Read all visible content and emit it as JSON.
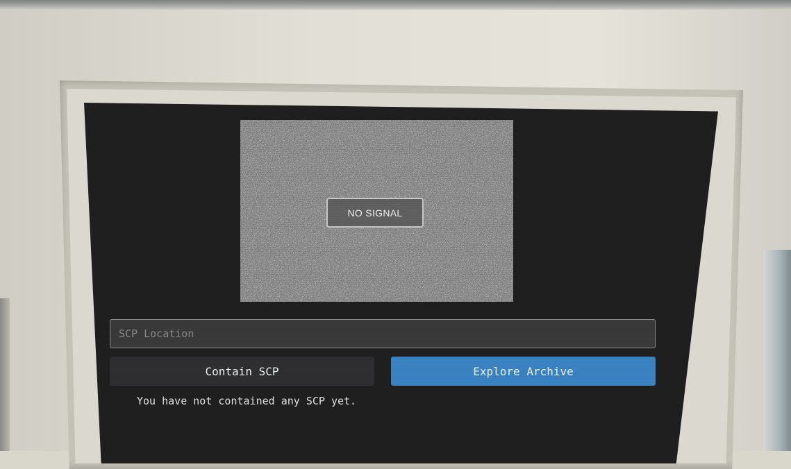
{
  "feed": {
    "status_label": "NO SIGNAL"
  },
  "controls": {
    "location_placeholder": "SCP Location",
    "location_value": "",
    "contain_button_label": "Contain SCP",
    "explore_button_label": "Explore Archive"
  },
  "status": {
    "message": "You have not contained any SCP yet."
  },
  "colors": {
    "screen_bg": "#1f1f1f",
    "primary_button": "#3b84c4",
    "secondary_button": "#2f2f31"
  }
}
